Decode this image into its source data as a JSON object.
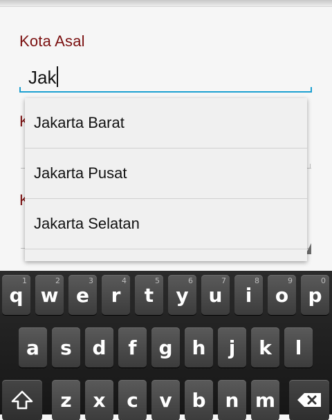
{
  "form": {
    "origin_label": "Kota Asal",
    "origin_value": "Jak",
    "field2_label_partial": "K",
    "field3_label_partial": "K"
  },
  "suggestions": [
    "Jakarta Barat",
    "Jakarta Pusat",
    "Jakarta Selatan"
  ],
  "keyboard": {
    "row1": [
      {
        "key": "q",
        "hint": "1"
      },
      {
        "key": "w",
        "hint": "2"
      },
      {
        "key": "e",
        "hint": "3"
      },
      {
        "key": "r",
        "hint": "4"
      },
      {
        "key": "t",
        "hint": "5"
      },
      {
        "key": "y",
        "hint": "6"
      },
      {
        "key": "u",
        "hint": "7"
      },
      {
        "key": "i",
        "hint": "8"
      },
      {
        "key": "o",
        "hint": "9"
      },
      {
        "key": "p",
        "hint": "0"
      }
    ],
    "row2": [
      "a",
      "s",
      "d",
      "f",
      "g",
      "h",
      "j",
      "k",
      "l"
    ],
    "row3": [
      "z",
      "x",
      "c",
      "v",
      "b",
      "n",
      "m"
    ],
    "shift_icon": "shift-arrow-icon",
    "backspace_icon": "backspace-icon"
  },
  "colors": {
    "label": "#7a0f0f",
    "focus_line": "#1a9fd0"
  }
}
